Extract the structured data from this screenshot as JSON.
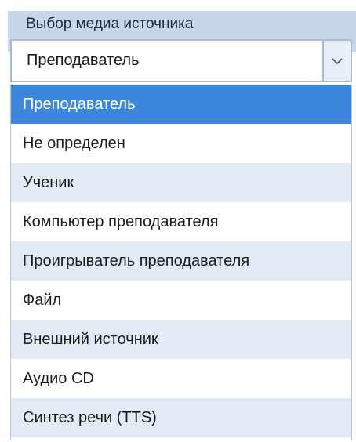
{
  "header": {
    "label": "Выбор медиа источника"
  },
  "combo": {
    "value": "Преподаватель",
    "arrow_icon": "chevron-down-icon"
  },
  "dropdown": {
    "items": [
      {
        "label": "Преподаватель"
      },
      {
        "label": "Не определен"
      },
      {
        "label": "Ученик"
      },
      {
        "label": "Компьютер преподавателя"
      },
      {
        "label": "Проигрыватель преподавателя"
      },
      {
        "label": "Файл"
      },
      {
        "label": "Внешний источник"
      },
      {
        "label": "Аудио CD"
      },
      {
        "label": "Синтез речи (TTS)"
      }
    ],
    "selected_index": 0
  },
  "colors": {
    "header_bg": "#c7d7eb",
    "selected_bg": "#3c86db",
    "alt_row_bg": "#e2ebf5",
    "border": "#a9b9cf"
  }
}
